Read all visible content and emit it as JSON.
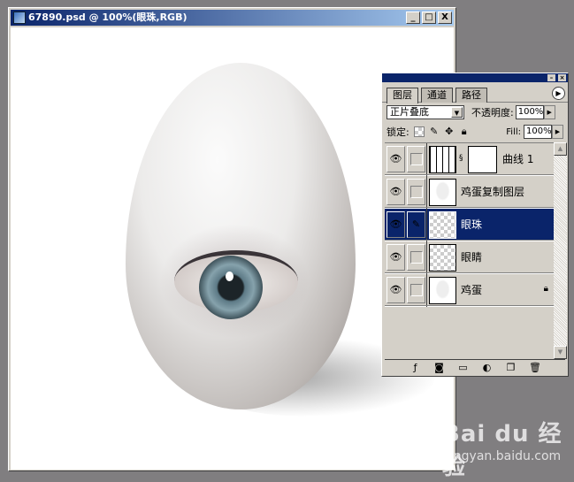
{
  "document": {
    "title": "67890.psd @ 100%(眼珠,RGB)",
    "buttons": {
      "minimize": "_",
      "maximize": "□",
      "close": "X"
    }
  },
  "layers_panel": {
    "tabs": [
      {
        "label": "图层",
        "active": true
      },
      {
        "label": "通道",
        "active": false
      },
      {
        "label": "路径",
        "active": false
      }
    ],
    "blend_mode": "正片叠底",
    "opacity_label": "不透明度:",
    "opacity": "100%",
    "lock_label": "锁定:",
    "fill_label": "Fill:",
    "fill": "100%",
    "layers": [
      {
        "name": "曲线 1",
        "visible": true,
        "selected": false,
        "type": "adjustment"
      },
      {
        "name": "鸡蛋复制图层",
        "visible": true,
        "selected": false,
        "type": "egg"
      },
      {
        "name": "眼珠",
        "visible": true,
        "selected": true,
        "type": "transparent"
      },
      {
        "name": "眼睛",
        "visible": true,
        "selected": false,
        "type": "eye"
      },
      {
        "name": "鸡蛋",
        "visible": true,
        "selected": false,
        "type": "egg",
        "locked": true
      }
    ]
  },
  "watermark": {
    "brand": "Bai du 经验",
    "url": "jingyan.baidu.com"
  }
}
